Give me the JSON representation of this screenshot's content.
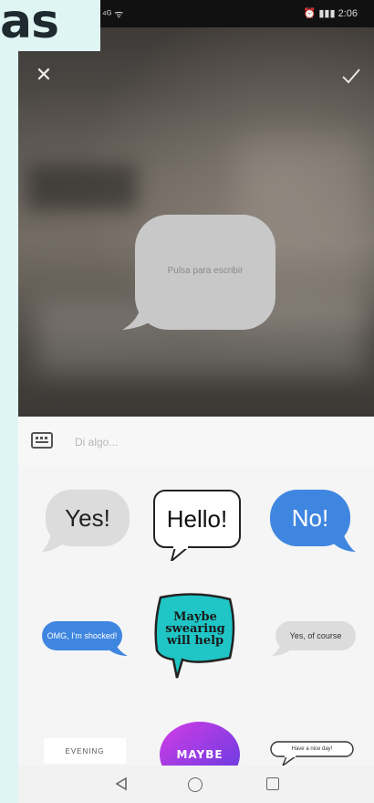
{
  "header": {
    "title_fragment": "as"
  },
  "status_bar": {
    "left": "⁴ᴳ ᯤ",
    "right": "⏰ ▮▮▮ 2:06"
  },
  "editor": {
    "bubble_placeholder": "Pulsa para escribir"
  },
  "input": {
    "placeholder": "Di algo..."
  },
  "stickers": {
    "yes": "Yes!",
    "hello": "Hello!",
    "no": "No!",
    "omg": "OMG, I'm shocked!",
    "maybe_swearing": "Maybe swearing will help",
    "yes_of_course": "Yes, of course",
    "evening": "EVENING",
    "maybe": "MAYBE",
    "nice_day": "Have a nice day!"
  },
  "colors": {
    "gray_bubble": "#dcdcdc",
    "blue_bubble": "#3f86e0",
    "teal_bubble": "#20c6c6",
    "purple_gradient": [
      "#d23de6",
      "#5d3be0"
    ]
  }
}
